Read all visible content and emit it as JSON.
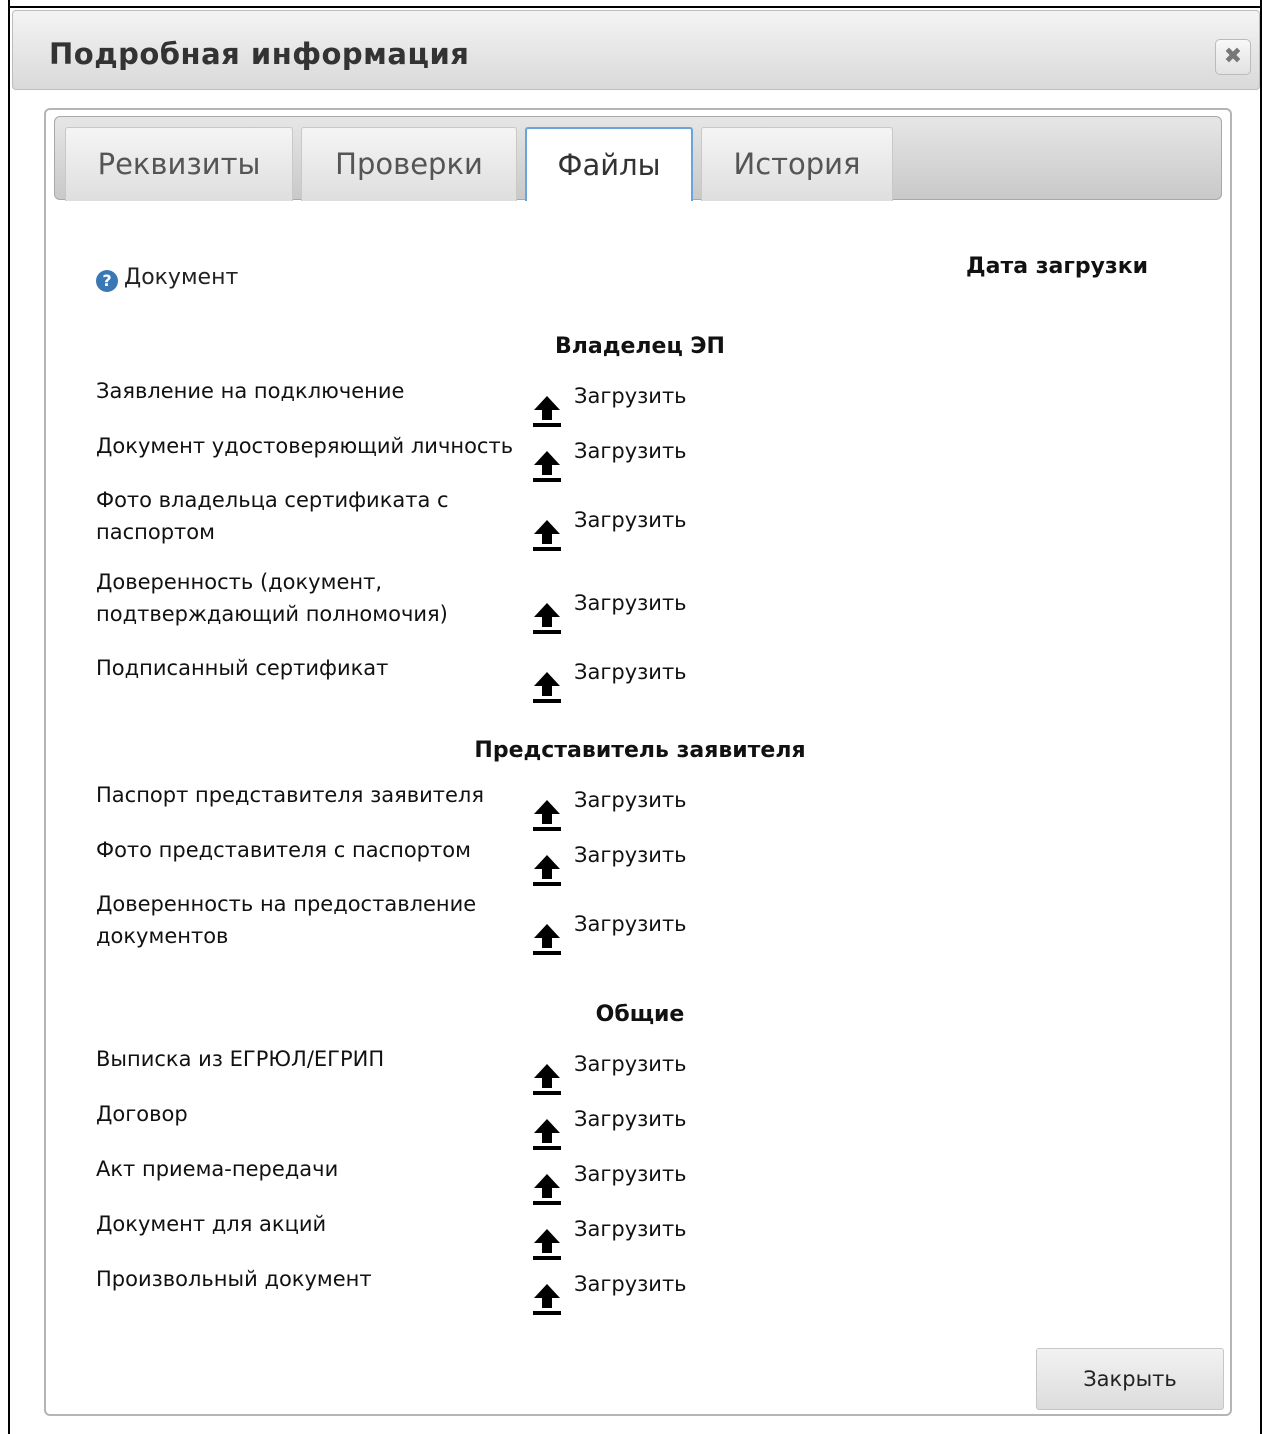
{
  "dialog": {
    "title": "Подробная информация",
    "close_icon": "✖"
  },
  "tabs": [
    {
      "label": "Реквизиты",
      "active": false
    },
    {
      "label": "Проверки",
      "active": false
    },
    {
      "label": "Файлы",
      "active": true
    },
    {
      "label": "История",
      "active": false
    }
  ],
  "header": {
    "help_icon": "?",
    "document": "Документ",
    "upload_date": "Дата загрузки"
  },
  "upload_label": "Загрузить",
  "sections": [
    {
      "title": "Владелец ЭП",
      "items": [
        {
          "line1": "Заявление на подключение",
          "line2": ""
        },
        {
          "line1": "Документ удостоверяющий личность",
          "line2": ""
        },
        {
          "line1": "Фото владельца сертификата с",
          "line2": "паспортом"
        },
        {
          "line1": "Доверенность (документ,",
          "line2": "подтверждающий полномочия)"
        },
        {
          "line1": "Подписанный сертификат",
          "line2": ""
        }
      ]
    },
    {
      "title": "Представитель заявителя",
      "items": [
        {
          "line1": "Паспорт представителя заявителя",
          "line2": ""
        },
        {
          "line1": "Фото представителя с паспортом",
          "line2": ""
        },
        {
          "line1": "Доверенность на предоставление",
          "line2": "документов"
        }
      ]
    },
    {
      "title": "Общие",
      "items": [
        {
          "line1": "Выписка из ЕГРЮЛ/ЕГРИП",
          "line2": ""
        },
        {
          "line1": "Договор",
          "line2": ""
        },
        {
          "line1": "Акт приема-передачи",
          "line2": ""
        },
        {
          "line1": "Документ для акций",
          "line2": ""
        },
        {
          "line1": "Произвольный документ",
          "line2": ""
        }
      ]
    }
  ],
  "footer": {
    "close_label": "Закрыть"
  },
  "colors": {
    "active_tab_border": "#6aa4dc",
    "help_icon": "#3a78b5"
  }
}
